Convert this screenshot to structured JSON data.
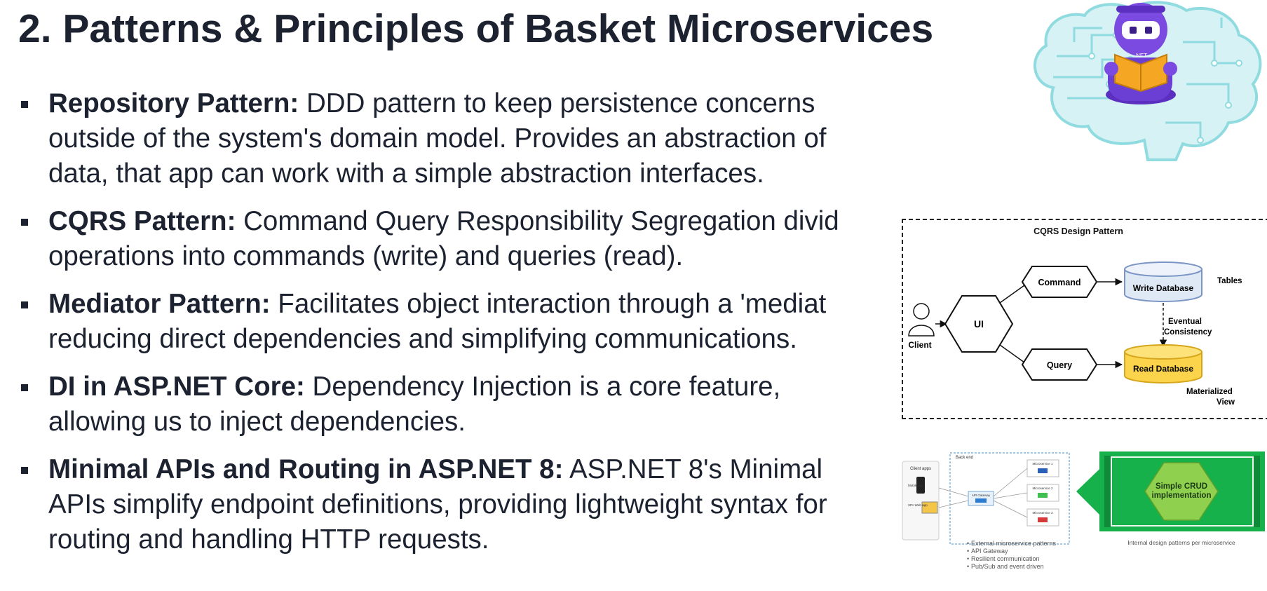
{
  "title": "2. Patterns & Principles of Basket Microservices",
  "bullets": [
    {
      "term": "Repository Pattern:",
      "lines": [
        "DDD pattern to keep persistence concerns",
        "outside of the system's domain model. Provides an abstraction of",
        "data, that app can work with a simple abstraction interfaces."
      ]
    },
    {
      "term": "CQRS Pattern:",
      "lines": [
        "Command Query Responsibility Segregation divid",
        "operations into commands (write) and queries (read)."
      ]
    },
    {
      "term": "Mediator Pattern:",
      "lines": [
        "Facilitates object interaction through a 'mediat",
        "reducing direct dependencies and simplifying communications."
      ]
    },
    {
      "term": "DI in ASP.NET Core:",
      "lines": [
        "Dependency Injection is a core feature,",
        "allowing us to inject dependencies."
      ]
    },
    {
      "term": "Minimal APIs and Routing in ASP.NET 8:",
      "lines": [
        "ASP.NET 8's Minimal",
        "APIs simplify endpoint definitions, providing lightweight syntax for",
        "routing and handling HTTP requests."
      ]
    }
  ],
  "cqrs_diagram": {
    "title": "CQRS Design Pattern",
    "client": "Client",
    "ui": "UI",
    "command": "Command",
    "query": "Query",
    "write_db": "Write Database",
    "read_db": "Read Database",
    "tables": "Tables",
    "eventual": "Eventual",
    "consistency": "Consistency",
    "materialized": "Materialized",
    "view": "View"
  },
  "micro_diagram": {
    "client_apps": "Client apps",
    "back_end": "Back end",
    "api_gateway": "API Gateway",
    "microservices": [
      "Microservice 1",
      "Microservice 2",
      "Microservice 3"
    ],
    "client_labels": [
      "Mobile app",
      "SPA Web app"
    ],
    "notes": [
      "External microservice patterns",
      "API Gateway",
      "Resilient communication",
      "Pub/Sub and event driven"
    ],
    "simple_crud": [
      "Simple CRUD",
      "implementation"
    ],
    "internal_caption": "Internal design patterns per microservice"
  },
  "colors": {
    "text": "#1c2230",
    "brain_fill": "#d6f2f4",
    "brain_stroke": "#7fd3da",
    "bot_purple": "#6b3fd4",
    "book_orange": "#f5a623",
    "write_db": "#dfe8f5",
    "read_db": "#fbd44b",
    "green": "#17b14b",
    "hex_green": "#8fd14f"
  },
  "mascot": {
    "badge": ".NET"
  }
}
